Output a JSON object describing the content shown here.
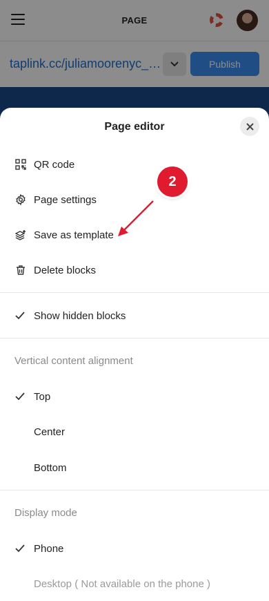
{
  "topbar": {
    "title": "PAGE"
  },
  "urlbar": {
    "url": "taplink.cc/juliamoorenyc_c...",
    "publish_label": "Publish"
  },
  "sheet": {
    "title": "Page editor",
    "actions": [
      {
        "label": "QR code",
        "icon": "qr-code-icon"
      },
      {
        "label": "Page settings",
        "icon": "gear-icon"
      },
      {
        "label": "Save as template",
        "icon": "layers-plus-icon"
      },
      {
        "label": "Delete blocks",
        "icon": "trash-icon"
      }
    ],
    "show_hidden": {
      "label": "Show hidden blocks",
      "checked": true
    },
    "alignment": {
      "heading": "Vertical content alignment",
      "options": [
        {
          "label": "Top",
          "checked": true
        },
        {
          "label": "Center",
          "checked": false
        },
        {
          "label": "Bottom",
          "checked": false
        }
      ]
    },
    "display": {
      "heading": "Display mode",
      "options": [
        {
          "label": "Phone",
          "checked": true,
          "disabled": false
        },
        {
          "label": "Desktop ( Not available on the phone )",
          "checked": false,
          "disabled": true
        }
      ]
    }
  },
  "callout": {
    "number": "2",
    "color": "#e01b30"
  },
  "colors": {
    "publish": "#3a8df0",
    "link": "#1f6fcf"
  }
}
